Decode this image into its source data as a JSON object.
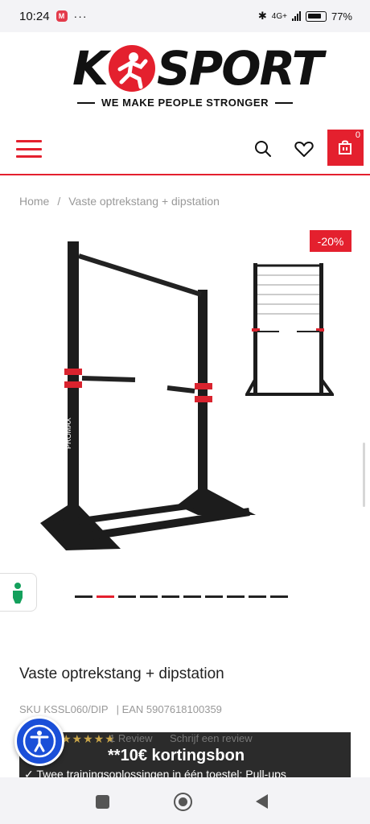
{
  "status_bar": {
    "time": "10:24",
    "app_badge": "M",
    "more": "···",
    "network": "4G+",
    "battery": "77%"
  },
  "brand": {
    "logo_left": "K",
    "logo_right": "SPORT",
    "tagline": "WE MAKE PEOPLE STRONGER",
    "accent_color": "#e4202e"
  },
  "header": {
    "cart_count": "0",
    "icons": [
      "menu-icon",
      "search-icon",
      "heart-icon",
      "cart-icon"
    ]
  },
  "breadcrumb": {
    "home": "Home",
    "separator": "/",
    "current": "Vaste optrekstang + dipstation"
  },
  "gallery": {
    "discount": "-20%",
    "slide_count": 10,
    "active_slide": 2
  },
  "product": {
    "title": "Vaste optrekstang + dipstation",
    "sku_label": "SKU",
    "sku": "KSSL060/DIP",
    "ean_label": "| EAN",
    "ean": "5907618100359",
    "stars": "★★★★★",
    "review_count": "1 Review",
    "write_review": "Schrijf een review",
    "coupon": "**10€ kortingsbon",
    "usp": "✓ Twee trainingsoplossingen in één toestel: Pull-ups"
  },
  "system_nav": {
    "icons": [
      "recents-icon",
      "home-icon",
      "back-icon"
    ]
  }
}
